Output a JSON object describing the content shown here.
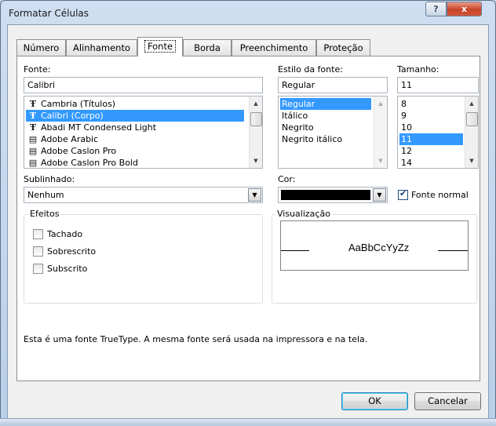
{
  "window": {
    "title": "Formatar Células",
    "help_label": "?",
    "close_label": "x"
  },
  "tabs": [
    {
      "label": "Número"
    },
    {
      "label": "Alinhamento"
    },
    {
      "label": "Fonte",
      "active": true
    },
    {
      "label": "Borda"
    },
    {
      "label": "Preenchimento"
    },
    {
      "label": "Proteção"
    }
  ],
  "font": {
    "label": "Fonte:",
    "value": "Calibri",
    "items": [
      {
        "label": "Cambria (Títulos)",
        "icon": "truetype-icon"
      },
      {
        "label": "Calibri (Corpo)",
        "icon": "truetype-icon",
        "selected": true
      },
      {
        "label": "Abadi MT Condensed Light",
        "icon": "truetype-icon"
      },
      {
        "label": "Adobe Arabic",
        "icon": "opentype-icon"
      },
      {
        "label": "Adobe Caslon Pro",
        "icon": "opentype-icon"
      },
      {
        "label": "Adobe Caslon Pro Bold",
        "icon": "opentype-icon"
      }
    ]
  },
  "style": {
    "label": "Estilo da fonte:",
    "value": "Regular",
    "items": [
      {
        "label": "Regular",
        "selected": true
      },
      {
        "label": "Itálico"
      },
      {
        "label": "Negrito"
      },
      {
        "label": "Negrito itálico"
      }
    ]
  },
  "size": {
    "label": "Tamanho:",
    "value": "11",
    "items": [
      {
        "label": "8"
      },
      {
        "label": "9"
      },
      {
        "label": "10"
      },
      {
        "label": "11",
        "selected": true
      },
      {
        "label": "12"
      },
      {
        "label": "14"
      }
    ]
  },
  "underline": {
    "label": "Sublinhado:",
    "value": "Nenhum"
  },
  "color": {
    "label": "Cor:",
    "value_hex": "#000000",
    "normal_font_label": "Fonte normal",
    "normal_font_checked": true
  },
  "effects": {
    "label": "Efeitos",
    "items": [
      {
        "label": "Tachado",
        "checked": false
      },
      {
        "label": "Sobrescrito",
        "checked": false
      },
      {
        "label": "Subscrito",
        "checked": false
      }
    ]
  },
  "preview": {
    "label": "Visualização",
    "sample": "AaBbCcYyZz"
  },
  "info_text": "Esta é uma fonte TrueType. A mesma fonte será usada na impressora e na tela.",
  "buttons": {
    "ok": "OK",
    "cancel": "Cancelar"
  }
}
